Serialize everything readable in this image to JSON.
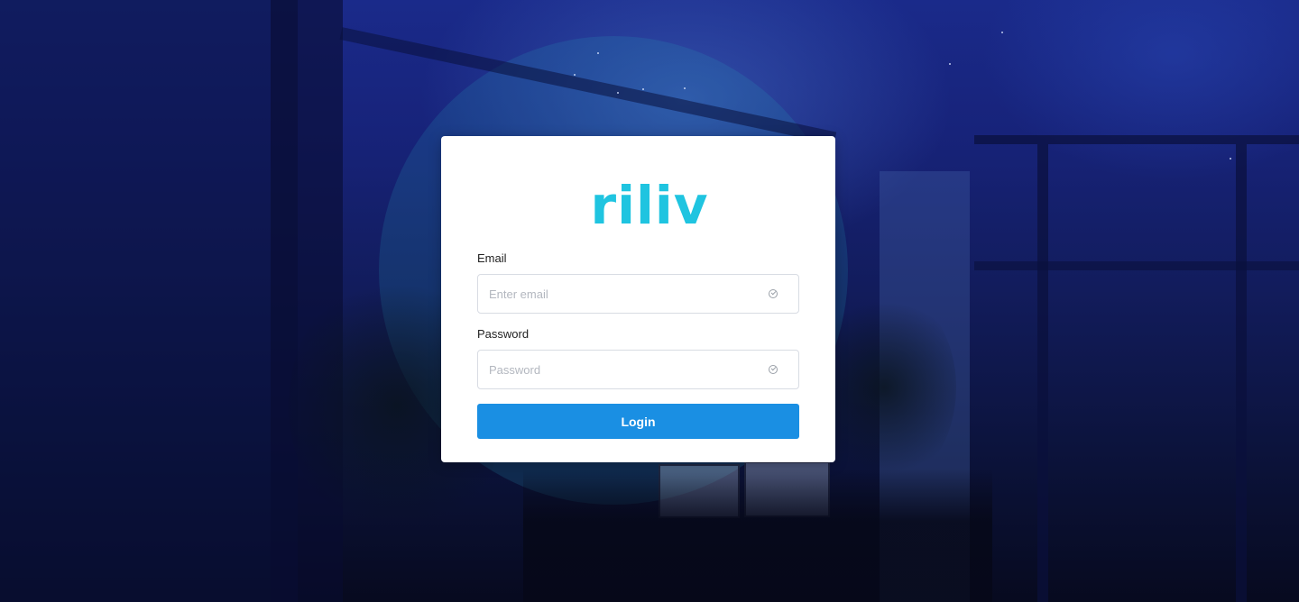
{
  "logo": {
    "text": "riliv",
    "color": "#1fc4e0"
  },
  "form": {
    "email": {
      "label": "Email",
      "placeholder": "Enter email",
      "value": "",
      "icon": "check-circle-icon"
    },
    "password": {
      "label": "Password",
      "placeholder": "Password",
      "value": "",
      "icon": "check-circle-icon"
    },
    "submit_label": "Login"
  },
  "colors": {
    "accent": "#1a8fe3",
    "card_background": "#ffffff",
    "background_top": "#1a2a8a",
    "background_bottom": "#070a1f"
  }
}
